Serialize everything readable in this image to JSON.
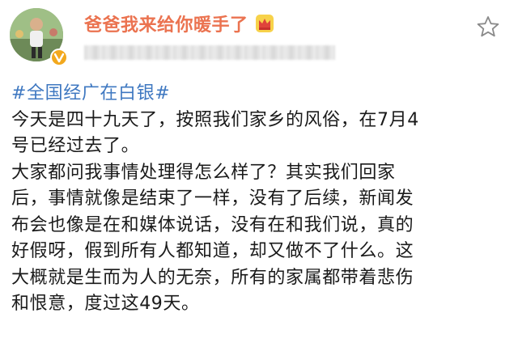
{
  "post": {
    "username": "爸爸我来给你暖手了",
    "hashtag": "#全国经广在白银#",
    "lines": [
      "今天是四十九天了，按照我们家乡的风俗，在7月4",
      "号已经过去了。",
      "大家都问我事情处理得怎么样了？其实我们回家",
      "后，事情就像是结束了一样，没有了后续，新闻发",
      "布会也像是在和媒体说话，没有在和我们说，真的",
      "好假呀，假到所有人都知道，却又做不了什么。这",
      "大概就是生而为人的无奈，所有的家属都带着悲伤",
      "和恨意，度过这49天。"
    ]
  },
  "icons": {
    "badge": "verified-badge-icon",
    "crown": "crown-icon",
    "star": "star-icon"
  },
  "colors": {
    "username": "#eb7350",
    "hashtag": "#3f78c1",
    "text": "#1a1a1a",
    "badge": "#f2a81d"
  }
}
